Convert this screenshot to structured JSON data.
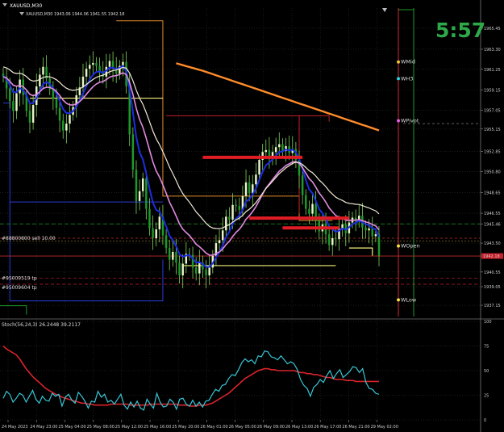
{
  "header": {
    "symbol": "XAUUSD,M30",
    "ohlc": "1943.06 1944.06 1941.55 1942.18"
  },
  "timer": "5:57",
  "colors": {
    "background": "#000000",
    "grid": "#2c2c2c",
    "bull_candle": "#e8f3c8",
    "bear_candle": "#1d9a2a",
    "wick": "#7fd35a",
    "ma_fast": "#1c2ee0",
    "ma_pink": "#e08ae0",
    "ma_white": "#f2ead8",
    "ma_orange": "#ff8c2a",
    "stoch_main": "#38c6d6",
    "stoch_signal": "#d8242a",
    "resistance_bar": "#e01c24",
    "yellow_line": "#f4f07a",
    "timer": "#2fa84a"
  },
  "chart_data": [
    {
      "type": "candlestick",
      "title": "XAUUSD,M30",
      "ylim": [
        1936.0,
        1967.5
      ],
      "y_ticks": [
        1965.45,
        1963.3,
        1961.25,
        1959.15,
        1957.05,
        1955.15,
        1952.85,
        1950.8,
        1948.65,
        1946.55,
        1945.46,
        1943.5,
        1942.18,
        1940.55,
        1939.05,
        1937.15
      ],
      "x_tick_labels": [
        "24 May 2023",
        "24 May 23:00",
        "25 May 04:00",
        "25 May 08:00",
        "25 May 12:00",
        "25 May 16:00",
        "25 May 20:00",
        "26 May 01:00",
        "26 May 05:00",
        "26 May 09:00",
        "26 May 13:00",
        "26 May 17:00",
        "26 May 21:00",
        "29 May 02:00"
      ],
      "current_price": "1942.18",
      "pivot_labels": [
        {
          "text": "WMid",
          "price": 1962.0,
          "color": "#f0c030"
        },
        {
          "text": "WH3",
          "price": 1960.3,
          "color": "#28d4e0"
        },
        {
          "text": "WPivot",
          "price": 1956.0,
          "color": "#e060e0"
        },
        {
          "text": "WOpen",
          "price": 1943.2,
          "color": "#f0e040"
        },
        {
          "text": "WLow",
          "price": 1937.7,
          "color": "#f0e040"
        }
      ],
      "order_labels": [
        "#88800800 sell 10.00",
        "#95009519 tp",
        "#95009604 tp"
      ],
      "resistance_levels": [
        1952.25,
        1946.05,
        1945.05
      ],
      "closes": [
        1960.5,
        1959.3,
        1958.0,
        1957.0,
        1958.8,
        1960.2,
        1958.6,
        1957.0,
        1955.8,
        1957.6,
        1959.5,
        1960.7,
        1961.5,
        1960.3,
        1959.2,
        1958.2,
        1957.3,
        1956.0,
        1955.0,
        1955.7,
        1956.6,
        1957.4,
        1958.6,
        1959.4,
        1960.5,
        1961.3,
        1961.7,
        1961.9,
        1961.6,
        1961.0,
        1960.5,
        1961.5,
        1962.1,
        1961.3,
        1960.8,
        1961.6,
        1962.0,
        1959.5,
        1954.6,
        1951.0,
        1947.8,
        1948.8,
        1950.1,
        1947.0,
        1945.0,
        1944.0,
        1944.9,
        1946.2,
        1944.3,
        1943.0,
        1941.8,
        1942.6,
        1941.5,
        1940.2,
        1941.4,
        1942.4,
        1942.3,
        1941.0,
        1940.4,
        1941.5,
        1940.8,
        1940.2,
        1941.0,
        1942.2,
        1943.5,
        1943.8,
        1944.8,
        1946.2,
        1945.9,
        1947.4,
        1947.3,
        1946.9,
        1948.3,
        1949.7,
        1948.6,
        1949.5,
        1950.5,
        1952.0,
        1952.8,
        1953.0,
        1952.3,
        1952.8,
        1953.3,
        1953.6,
        1952.9,
        1953.4,
        1952.7,
        1953.1,
        1952.0,
        1950.4,
        1948.4,
        1947.0,
        1946.5,
        1947.5,
        1945.8,
        1944.7,
        1945.4,
        1944.4,
        1943.3,
        1944.0,
        1943.9,
        1945.0,
        1945.4,
        1944.5,
        1945.6,
        1946.1,
        1945.8,
        1946.3,
        1945.1,
        1944.8,
        1945.0,
        1944.2,
        1944.4,
        1942.2
      ],
      "stochastic": {
        "label": "Stoch(56,24,3) 26.2448 39.2117",
        "ylim": [
          0,
          100
        ],
        "y_ticks": [
          0,
          25,
          50,
          75,
          100
        ],
        "main_value": 26.2448,
        "signal_value": 39.2117,
        "main": [
          22,
          29,
          26,
          18,
          22,
          27,
          25,
          18,
          24,
          30,
          21,
          17,
          24,
          20,
          19,
          27,
          24,
          26,
          14,
          23,
          26,
          20,
          17,
          28,
          24,
          19,
          12,
          19,
          18,
          29,
          23,
          26,
          18,
          20,
          16,
          21,
          26,
          15,
          11,
          18,
          13,
          19,
          12,
          10,
          21,
          16,
          12,
          27,
          18,
          13,
          14,
          21,
          18,
          11,
          21,
          22,
          16,
          14,
          20,
          14,
          18,
          13,
          19,
          20,
          26,
          31,
          29,
          35,
          36,
          42,
          46,
          45,
          51,
          58,
          62,
          59,
          61,
          57,
          65,
          64,
          70,
          69,
          64,
          63,
          61,
          65,
          61,
          57,
          59,
          57,
          51,
          41,
          35,
          32,
          24,
          33,
          36,
          41,
          38,
          45,
          50,
          42,
          47,
          51,
          43,
          46,
          49,
          54,
          53,
          48,
          52,
          38,
          32,
          31,
          27,
          26
        ],
        "signal": [
          75,
          72,
          70,
          68,
          66,
          62,
          57,
          52,
          48,
          44,
          41,
          38,
          35,
          32,
          30,
          28,
          26,
          25,
          23,
          22,
          21,
          20,
          19,
          18,
          17,
          17,
          16,
          16,
          15,
          15,
          15,
          15,
          15,
          16,
          16,
          16,
          16,
          16,
          16,
          15,
          15,
          15,
          15,
          15,
          15,
          16,
          16,
          16,
          16,
          16,
          16,
          16,
          16,
          16,
          15,
          15,
          15,
          14,
          14,
          14,
          15,
          15,
          15,
          16,
          17,
          19,
          21,
          23,
          25,
          27,
          30,
          33,
          36,
          39,
          42,
          44,
          46,
          48,
          50,
          51,
          52,
          52,
          51,
          51,
          50,
          50,
          50,
          50,
          50,
          50,
          49,
          48,
          48,
          47,
          47,
          46,
          46,
          45,
          44,
          43,
          43,
          42,
          41,
          41,
          41,
          40,
          40,
          40,
          39,
          39,
          39,
          39,
          39,
          39,
          39,
          39
        ]
      }
    }
  ]
}
